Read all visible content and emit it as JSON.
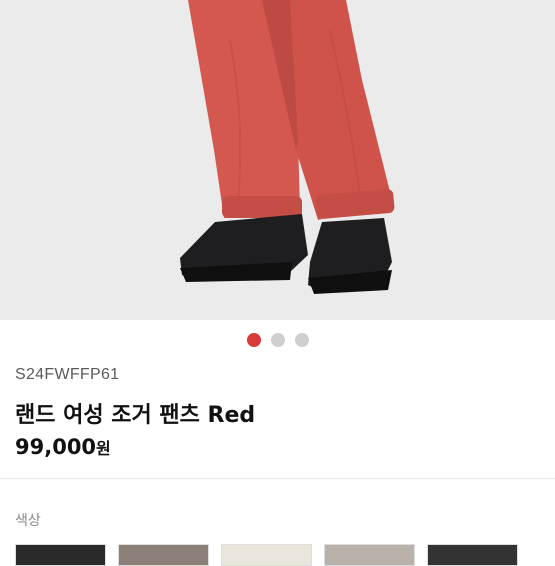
{
  "gallery": {
    "slide_count": 3,
    "active_index": 0
  },
  "product": {
    "code": "S24FWFFP61",
    "name": "랜드 여성 조거 팬츠 Red",
    "price": "99,000",
    "price_unit": "원"
  },
  "options": {
    "color_label": "색상",
    "swatches": [
      {
        "name": "black",
        "color": "#2a2a2a"
      },
      {
        "name": "grey-brown",
        "color": "#8c7f78"
      },
      {
        "name": "ivory",
        "color": "#ebe6dc"
      },
      {
        "name": "beige-grey",
        "color": "#b9b2aa"
      },
      {
        "name": "dark",
        "color": "#333333"
      }
    ]
  },
  "colors": {
    "accent": "#d93a3a",
    "pants": "#d45850",
    "background": "#ebebeb"
  }
}
